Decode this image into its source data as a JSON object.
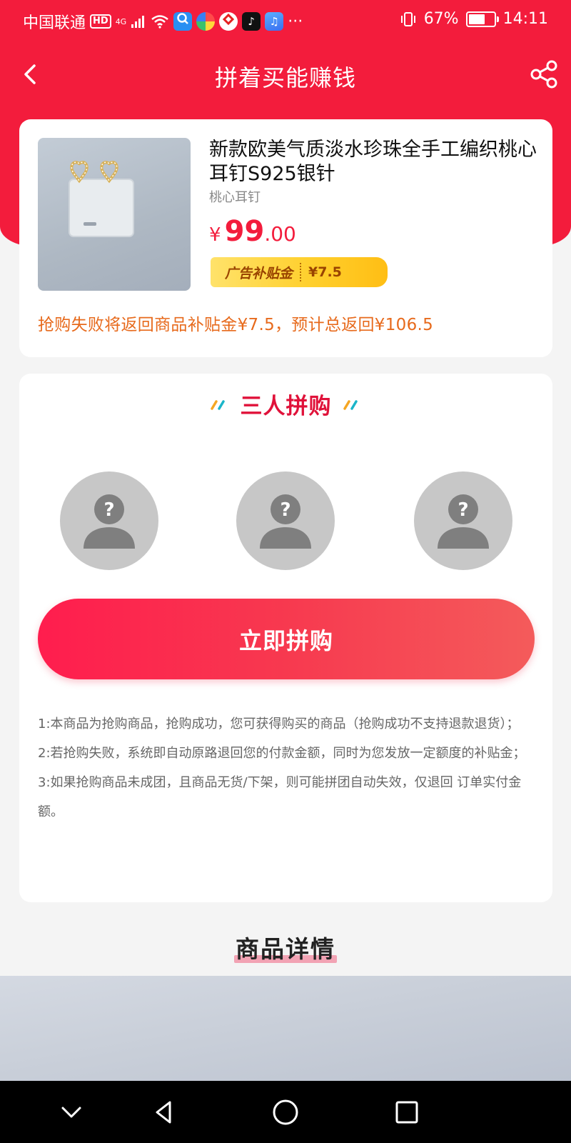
{
  "status_bar": {
    "carrier": "中国联通",
    "hd": "HD",
    "network": "4G",
    "more": "···",
    "battery_text": "67%",
    "battery_level": 0.67,
    "time": "14:11"
  },
  "nav": {
    "title": "拼着买能赚钱",
    "back_icon": "chevron-left-icon",
    "share_icon": "share-icon"
  },
  "product": {
    "title": "新款欧美气质淡水珍珠全手工编织桃心耳钉S925银针",
    "subtitle": "桃心耳钉",
    "price_symbol": "¥",
    "price_integer": "99",
    "price_decimal": ".00",
    "ad_badge_label": "广告补贴金",
    "ad_badge_value": "¥7.5",
    "refund_note": "抢购失败将返回商品补贴金¥7.5，预计总返回¥106.5"
  },
  "group": {
    "title": "三人拼购",
    "slots": [
      {
        "label": "?"
      },
      {
        "label": "?"
      },
      {
        "label": "?"
      }
    ],
    "button_label": "立即拼购",
    "rules": [
      "1:本商品为抢购商品，抢购成功，您可获得购买的商品（抢购成功不支持退款退货）；",
      "2:若抢购失败，系统即自动原路退回您的付款金额，同时为您发放一定额度的补贴金；",
      "3:如果抢购商品未成团，且商品无货/下架，则可能拼团自动失效，仅退回 订单实付金额。"
    ]
  },
  "detail": {
    "title": "商品详情"
  },
  "colors": {
    "primary": "#f31c3c",
    "note_orange": "#e76a1c",
    "badge_yellow": "#ffd02e",
    "avatar_gray": "#c7c7c7"
  }
}
